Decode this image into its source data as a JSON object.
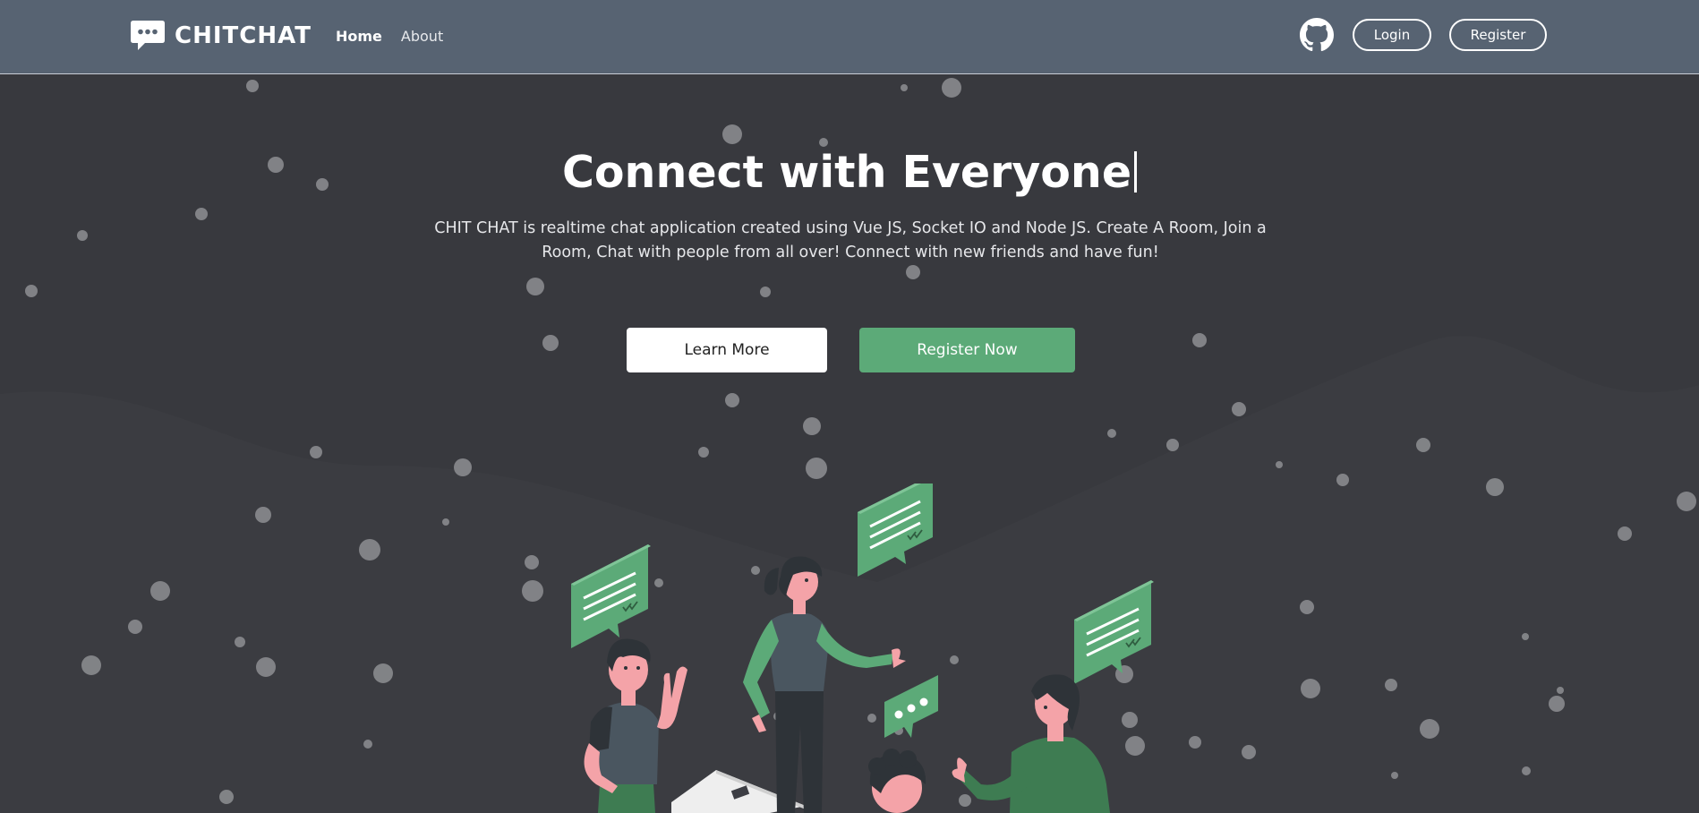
{
  "navbar": {
    "brand_name": "CHITCHAT",
    "links": [
      {
        "label": "Home",
        "active": true
      },
      {
        "label": "About",
        "active": false
      }
    ],
    "github_icon": "github-icon",
    "login_label": "Login",
    "register_label": "Register"
  },
  "hero": {
    "title": "Connect with Everyone",
    "description": "CHIT CHAT is realtime chat application created using Vue JS, Socket IO and Node JS. Create A Room, Join a Room, Chat with people from all over! Connect with new friends and have fun!",
    "learn_more_label": "Learn More",
    "register_now_label": "Register Now"
  },
  "colors": {
    "navbar_bg": "#576372",
    "page_bg": "#38393e",
    "accent_green": "#5caa78"
  }
}
